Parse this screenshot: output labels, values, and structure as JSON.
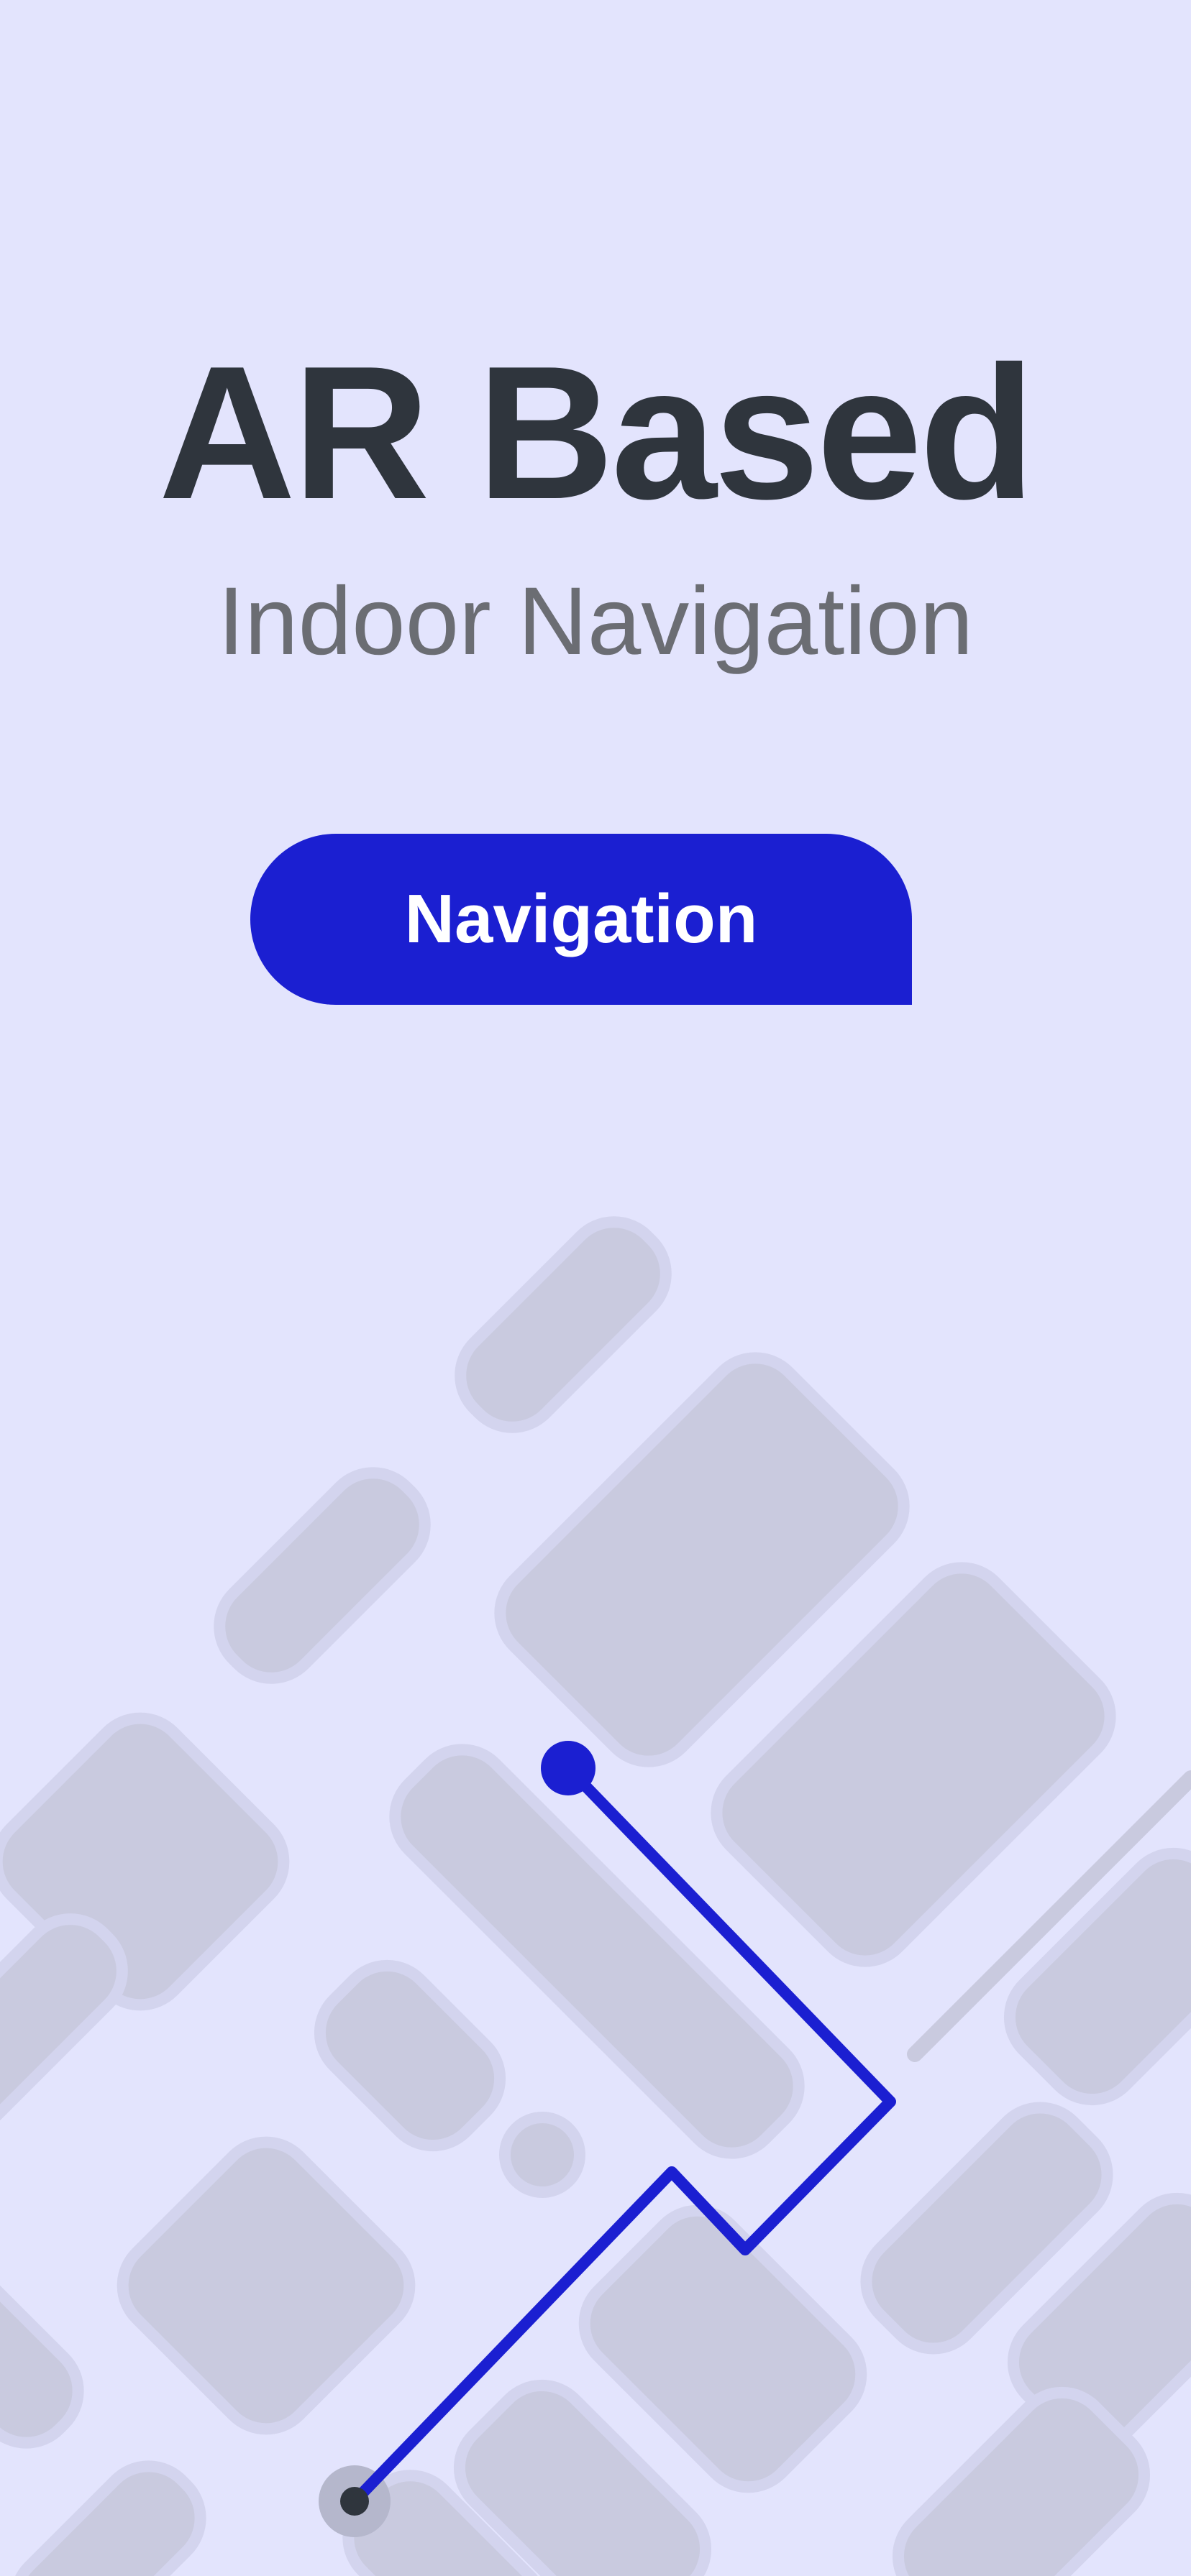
{
  "header": {
    "title": "AR Based",
    "subtitle": "Indoor Navigation"
  },
  "actions": {
    "navigation_label": "Navigation"
  },
  "colors": {
    "background": "#e3e4fd",
    "accent": "#1b1fd1",
    "title_text": "#2f353d",
    "subtitle_text": "#6b6d73",
    "map_block": "#c9cadf"
  }
}
